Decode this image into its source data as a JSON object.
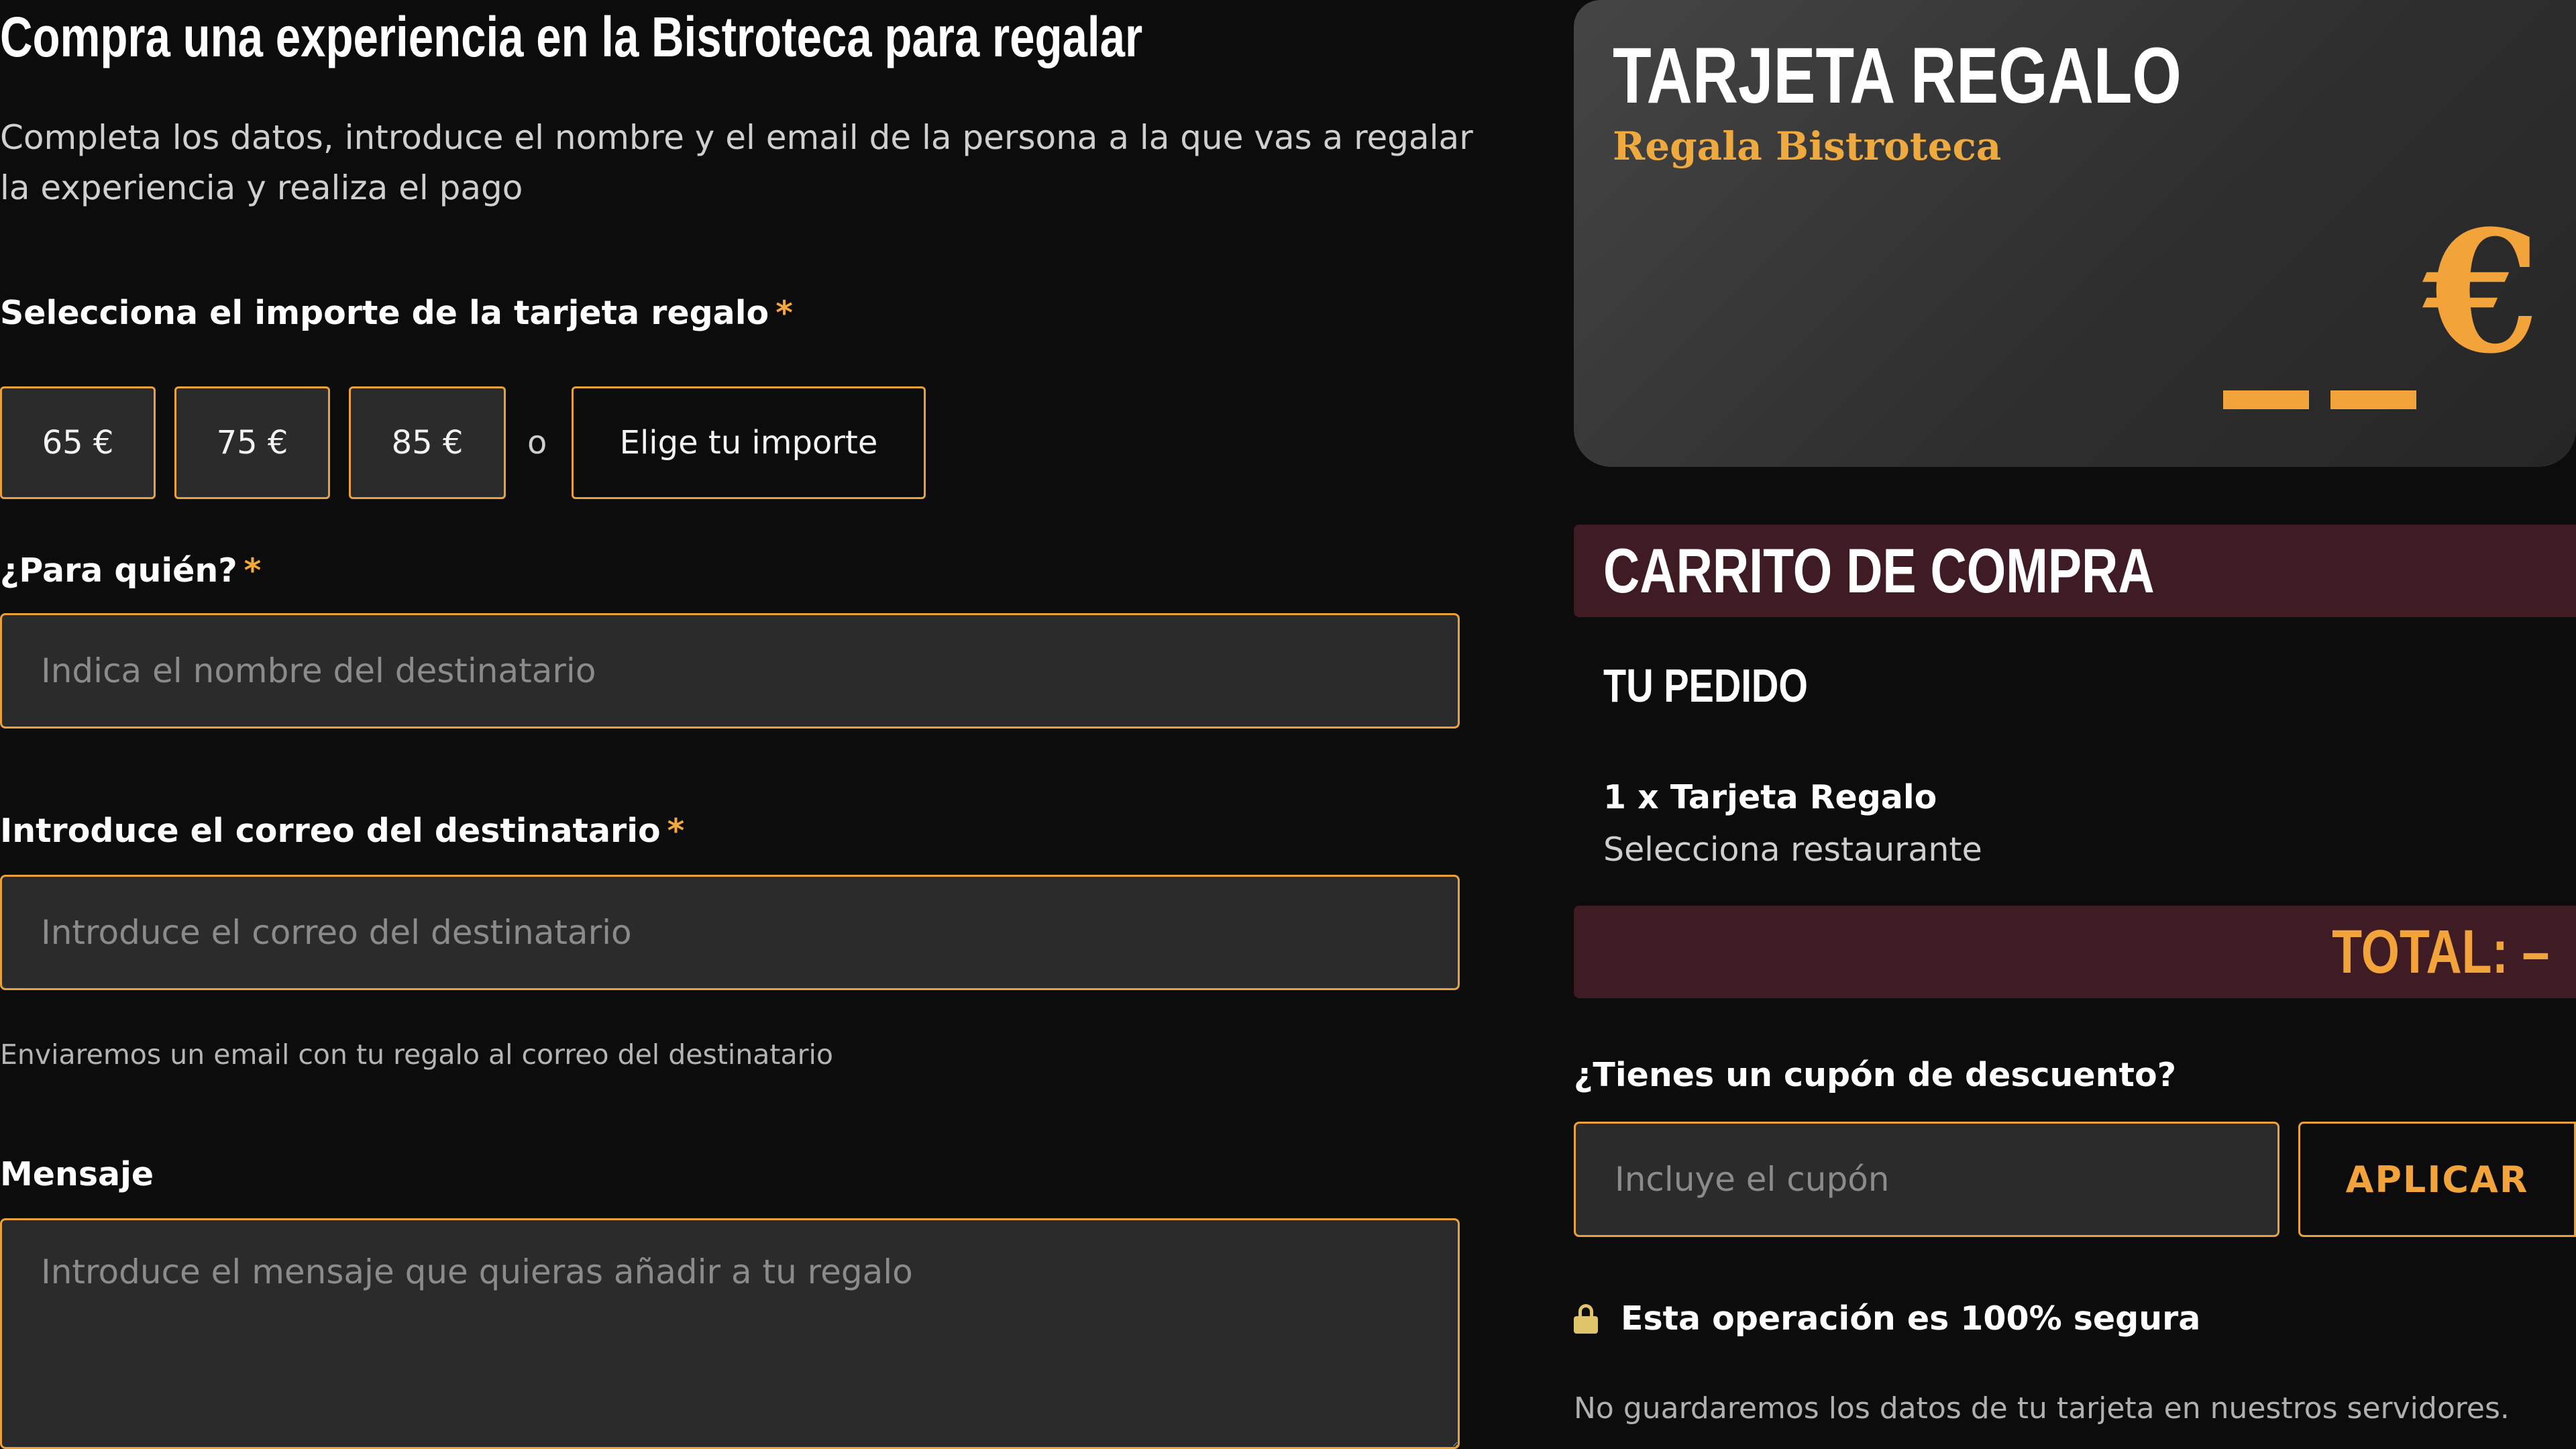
{
  "form": {
    "title": "Compra una experiencia en la Bistroteca para regalar",
    "intro_line1": "Completa los datos, introduce el nombre y el email de la persona a la que vas a regalar",
    "intro_line2": "la experiencia y realiza el pago",
    "amount": {
      "label": "Selecciona el importe de la tarjeta regalo",
      "required_mark": "*",
      "options": [
        "65 €",
        "75 €",
        "85 €"
      ],
      "separator": "o",
      "custom_label": "Elige tu importe"
    },
    "recipient_name": {
      "label": "¿Para quién?",
      "required_mark": "*",
      "placeholder": "Indica el nombre del destinatario",
      "value": ""
    },
    "recipient_email": {
      "label": "Introduce el correo del destinatario",
      "required_mark": "*",
      "placeholder": "Introduce el correo del destinatario",
      "value": "",
      "hint": "Enviaremos un email con tu regalo al correo del destinatario"
    },
    "message": {
      "label": "Mensaje",
      "placeholder": "Introduce el mensaje que quieras añadir a tu regalo",
      "value": ""
    }
  },
  "gift_card": {
    "title": "TARJETA REGALO",
    "subtitle": "Regala Bistroteca",
    "currency_symbol": "€",
    "accent_color": "#f2a33a"
  },
  "cart": {
    "header": "CARRITO DE COMPRA",
    "order_title": "TU PEDIDO",
    "item": "1 x Tarjeta Regalo",
    "item_detail": "Selecciona restaurante",
    "total": "TOTAL: –"
  },
  "coupon": {
    "label": "¿Tienes un cupón de descuento?",
    "placeholder": "Incluye el cupón",
    "value": "",
    "apply_label": "APLICAR"
  },
  "security": {
    "icon": "lock-icon",
    "text": "Esta operación es 100% segura",
    "disclaimer": "No guardaremos los datos de tu tarjeta en nuestros servidores."
  },
  "colors": {
    "background": "#0c0c0c",
    "accent": "#f2a33a",
    "input_bg": "#2b2b2b",
    "cart_bar": "#3f1b24"
  }
}
